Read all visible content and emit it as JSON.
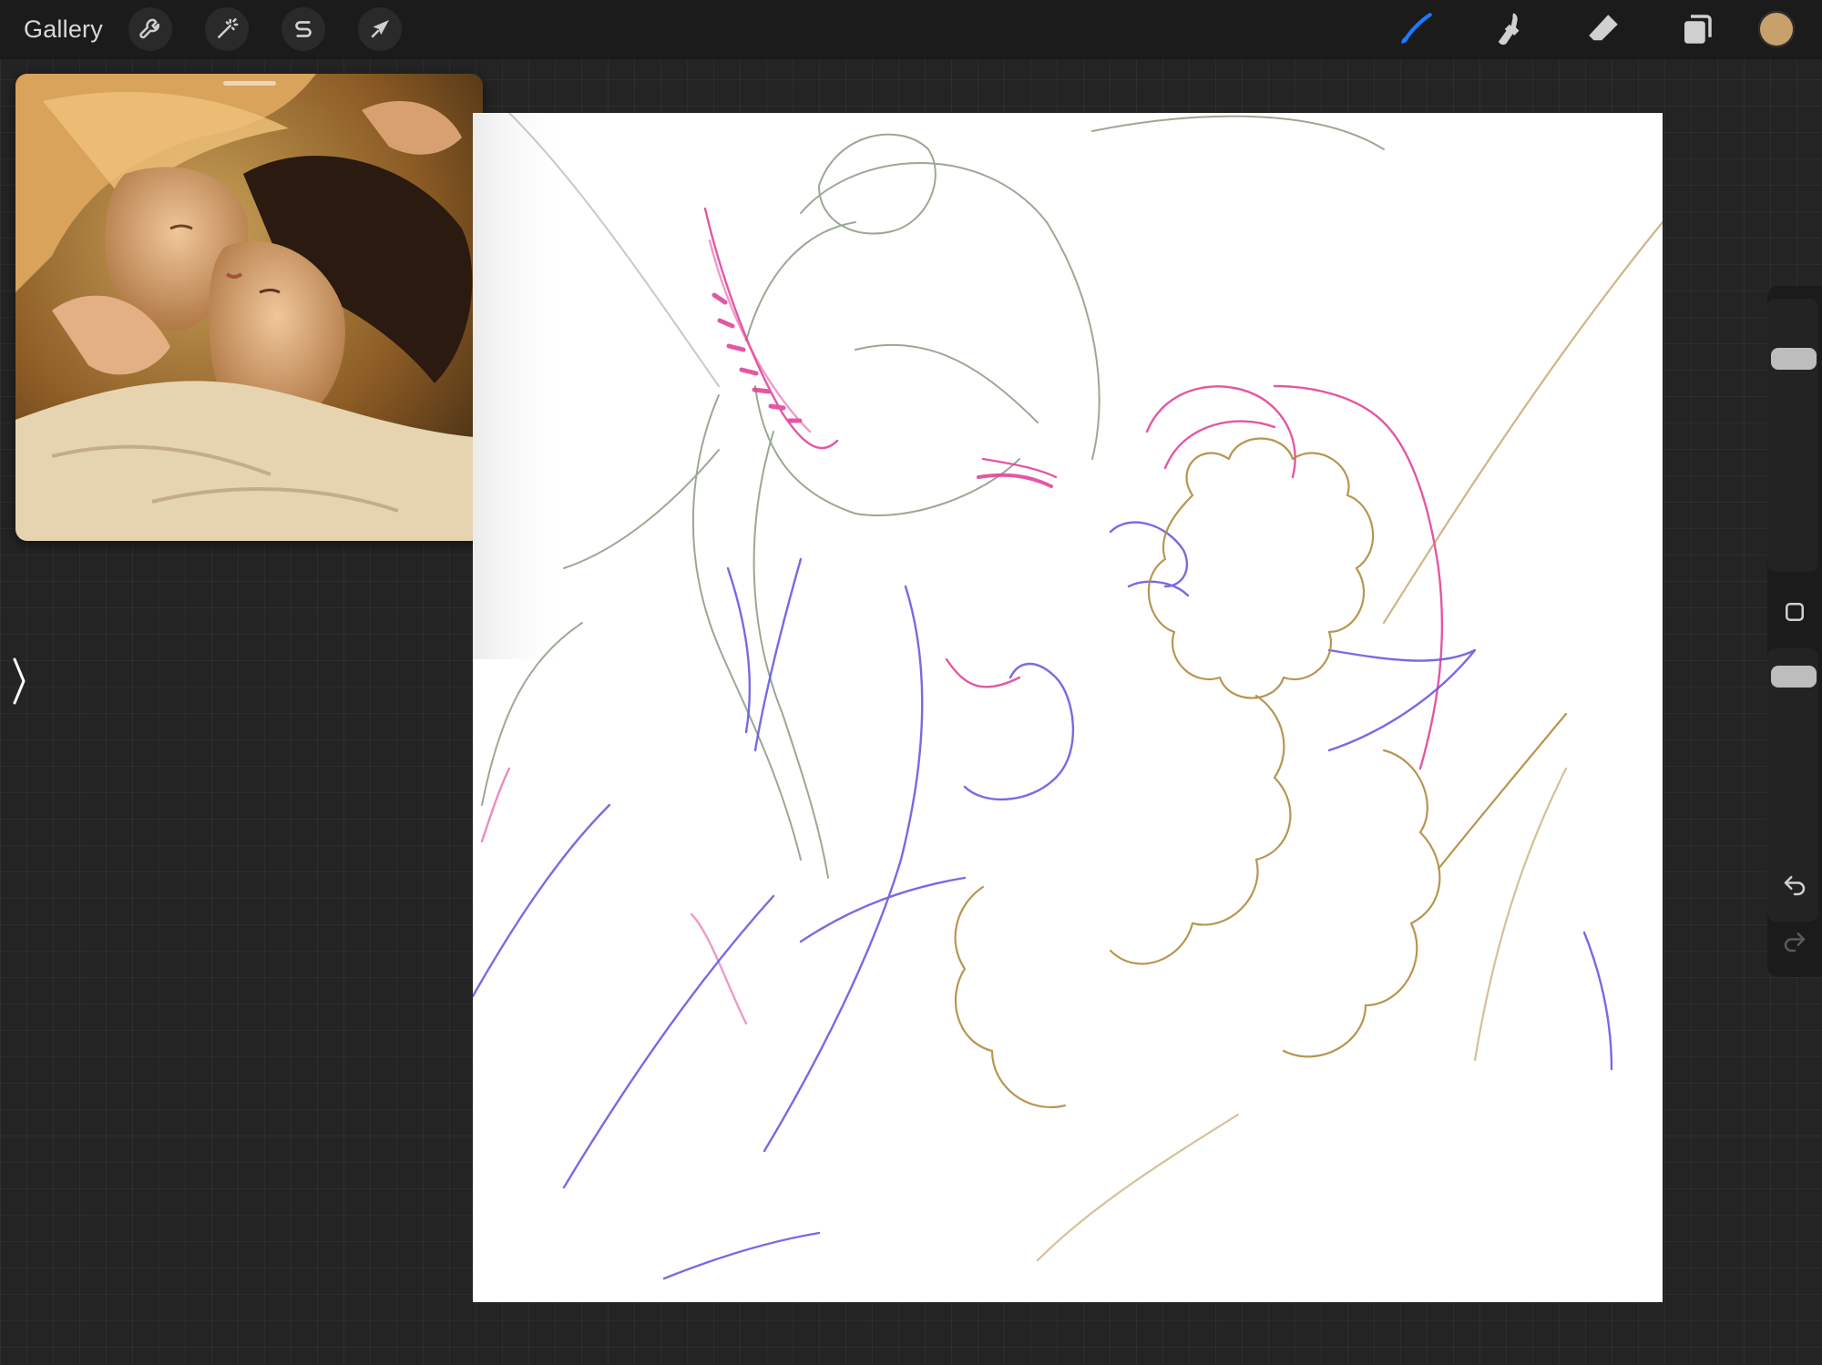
{
  "topbar": {
    "gallery_label": "Gallery",
    "left_tools": [
      {
        "name": "actions",
        "icon": "wrench-icon"
      },
      {
        "name": "adjustments",
        "icon": "magic-wand-icon"
      },
      {
        "name": "selection",
        "icon": "selection-s-icon"
      },
      {
        "name": "transform",
        "icon": "arrow-cursor-icon"
      }
    ],
    "right_tools": [
      {
        "name": "brush",
        "icon": "brush-icon",
        "active": true
      },
      {
        "name": "smudge",
        "icon": "smudge-icon",
        "active": false
      },
      {
        "name": "eraser",
        "icon": "eraser-icon",
        "active": false
      },
      {
        "name": "layers",
        "icon": "layers-icon",
        "active": false
      }
    ],
    "active_color": "#c8a06a",
    "accent_color": "#1a7bff"
  },
  "reference_window": {
    "content": "reference-photo"
  },
  "sidebar": {
    "brush_size_level": 0.18,
    "opacity_level": 0.95,
    "buttons": [
      {
        "name": "modify",
        "icon": "square-icon"
      },
      {
        "name": "undo",
        "icon": "undo-icon"
      },
      {
        "name": "redo",
        "icon": "redo-icon"
      }
    ]
  },
  "colors": {
    "canvas": "#ffffff",
    "background": "#242424",
    "sketch_pink": "#e0459a",
    "sketch_purple": "#6a5ae0",
    "sketch_olive": "#8a9a80",
    "sketch_gold": "#b08a3e"
  }
}
